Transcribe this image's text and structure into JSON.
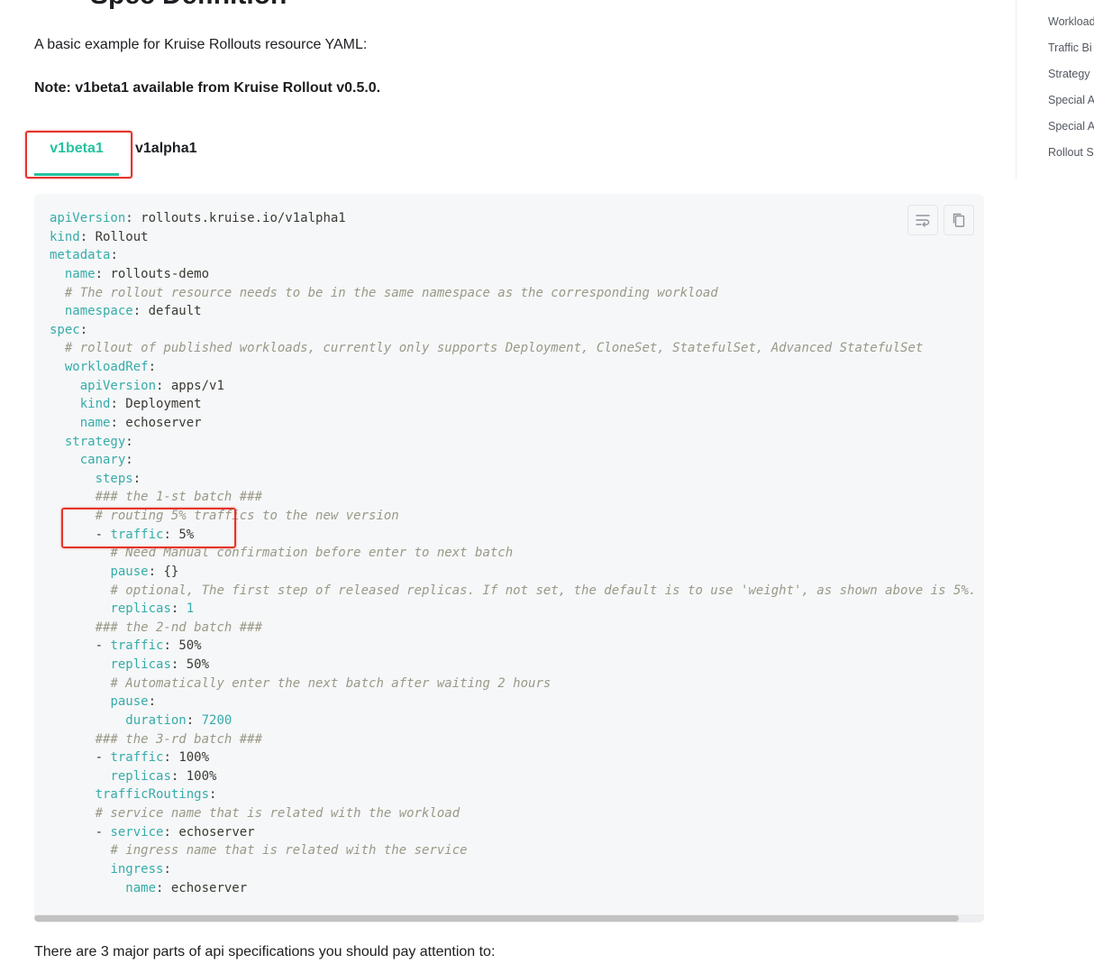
{
  "page": {
    "heading_partial": "Spec Definition",
    "intro": "A basic example for Kruise Rollouts resource YAML:",
    "note": "Note: v1beta1 available from Kruise Rollout v0.5.0.",
    "outro": "There are 3 major parts of api specifications you should pay attention to:"
  },
  "tabs": [
    {
      "label": "v1beta1",
      "active": true
    },
    {
      "label": "v1alpha1",
      "active": false
    }
  ],
  "code": {
    "language": "yaml",
    "buttons": {
      "wrap": "wrap-lines-icon",
      "copy": "copy-icon"
    },
    "lines": [
      {
        "indent": 0,
        "key": "apiVersion",
        "value": " rollouts.kruise.io/v1alpha1"
      },
      {
        "indent": 0,
        "key": "kind",
        "value": " Rollout"
      },
      {
        "indent": 0,
        "key": "metadata",
        "value": ""
      },
      {
        "indent": 2,
        "key": "name",
        "value": " rollouts-demo"
      },
      {
        "indent": 2,
        "comment": "# The rollout resource needs to be in the same namespace as the corresponding workload"
      },
      {
        "indent": 2,
        "key": "namespace",
        "value": " default"
      },
      {
        "indent": 0,
        "key": "spec",
        "value": ""
      },
      {
        "indent": 2,
        "comment": "# rollout of published workloads, currently only supports Deployment, CloneSet, StatefulSet, Advanced StatefulSet"
      },
      {
        "indent": 2,
        "key": "workloadRef",
        "value": ""
      },
      {
        "indent": 4,
        "key": "apiVersion",
        "value": " apps/v1"
      },
      {
        "indent": 4,
        "key": "kind",
        "value": " Deployment"
      },
      {
        "indent": 4,
        "key": "name",
        "value": " echoserver"
      },
      {
        "indent": 2,
        "key": "strategy",
        "value": ""
      },
      {
        "indent": 4,
        "key": "canary",
        "value": ""
      },
      {
        "indent": 6,
        "key": "steps",
        "value": ""
      },
      {
        "indent": 6,
        "comment": "### the 1-st batch ###"
      },
      {
        "indent": 6,
        "comment": "# routing 5% traffics to the new version"
      },
      {
        "indent": 6,
        "dash": true,
        "key": "traffic",
        "value": " 5%"
      },
      {
        "indent": 8,
        "comment": "# Need Manual confirmation before enter to next batch"
      },
      {
        "indent": 8,
        "key": "pause",
        "value": " {}"
      },
      {
        "indent": 8,
        "comment": "# optional, The first step of released replicas. If not set, the default is to use 'weight', as shown above is 5%."
      },
      {
        "indent": 8,
        "key": "replicas",
        "num": " 1"
      },
      {
        "indent": 6,
        "comment": "### the 2-nd batch ###"
      },
      {
        "indent": 6,
        "dash": true,
        "key": "traffic",
        "value": " 50%"
      },
      {
        "indent": 8,
        "key": "replicas",
        "value": " 50%"
      },
      {
        "indent": 8,
        "comment": "# Automatically enter the next batch after waiting 2 hours"
      },
      {
        "indent": 8,
        "key": "pause",
        "value": ""
      },
      {
        "indent": 10,
        "key": "duration",
        "num": " 7200"
      },
      {
        "indent": 6,
        "comment": "### the 3-rd batch ###"
      },
      {
        "indent": 6,
        "dash": true,
        "key": "traffic",
        "value": " 100%"
      },
      {
        "indent": 8,
        "key": "replicas",
        "value": " 100%"
      },
      {
        "indent": 6,
        "key": "trafficRoutings",
        "value": ""
      },
      {
        "indent": 6,
        "comment": "# service name that is related with the workload"
      },
      {
        "indent": 6,
        "dash": true,
        "key": "service",
        "value": " echoserver"
      },
      {
        "indent": 8,
        "comment": "# ingress name that is related with the service"
      },
      {
        "indent": 8,
        "key": "ingress",
        "value": ""
      },
      {
        "indent": 10,
        "key": "name",
        "value": " echoserver"
      }
    ]
  },
  "toc": {
    "items": [
      "Workload",
      "Traffic Bi",
      "Strategy",
      "Special A",
      "Special A",
      "Rollout S"
    ]
  },
  "colors": {
    "accent": "#25c2a0",
    "annotation": "#e5332a",
    "code_key": "#36acaa",
    "code_comment": "#999988",
    "code_bg": "#f6f7f8"
  }
}
